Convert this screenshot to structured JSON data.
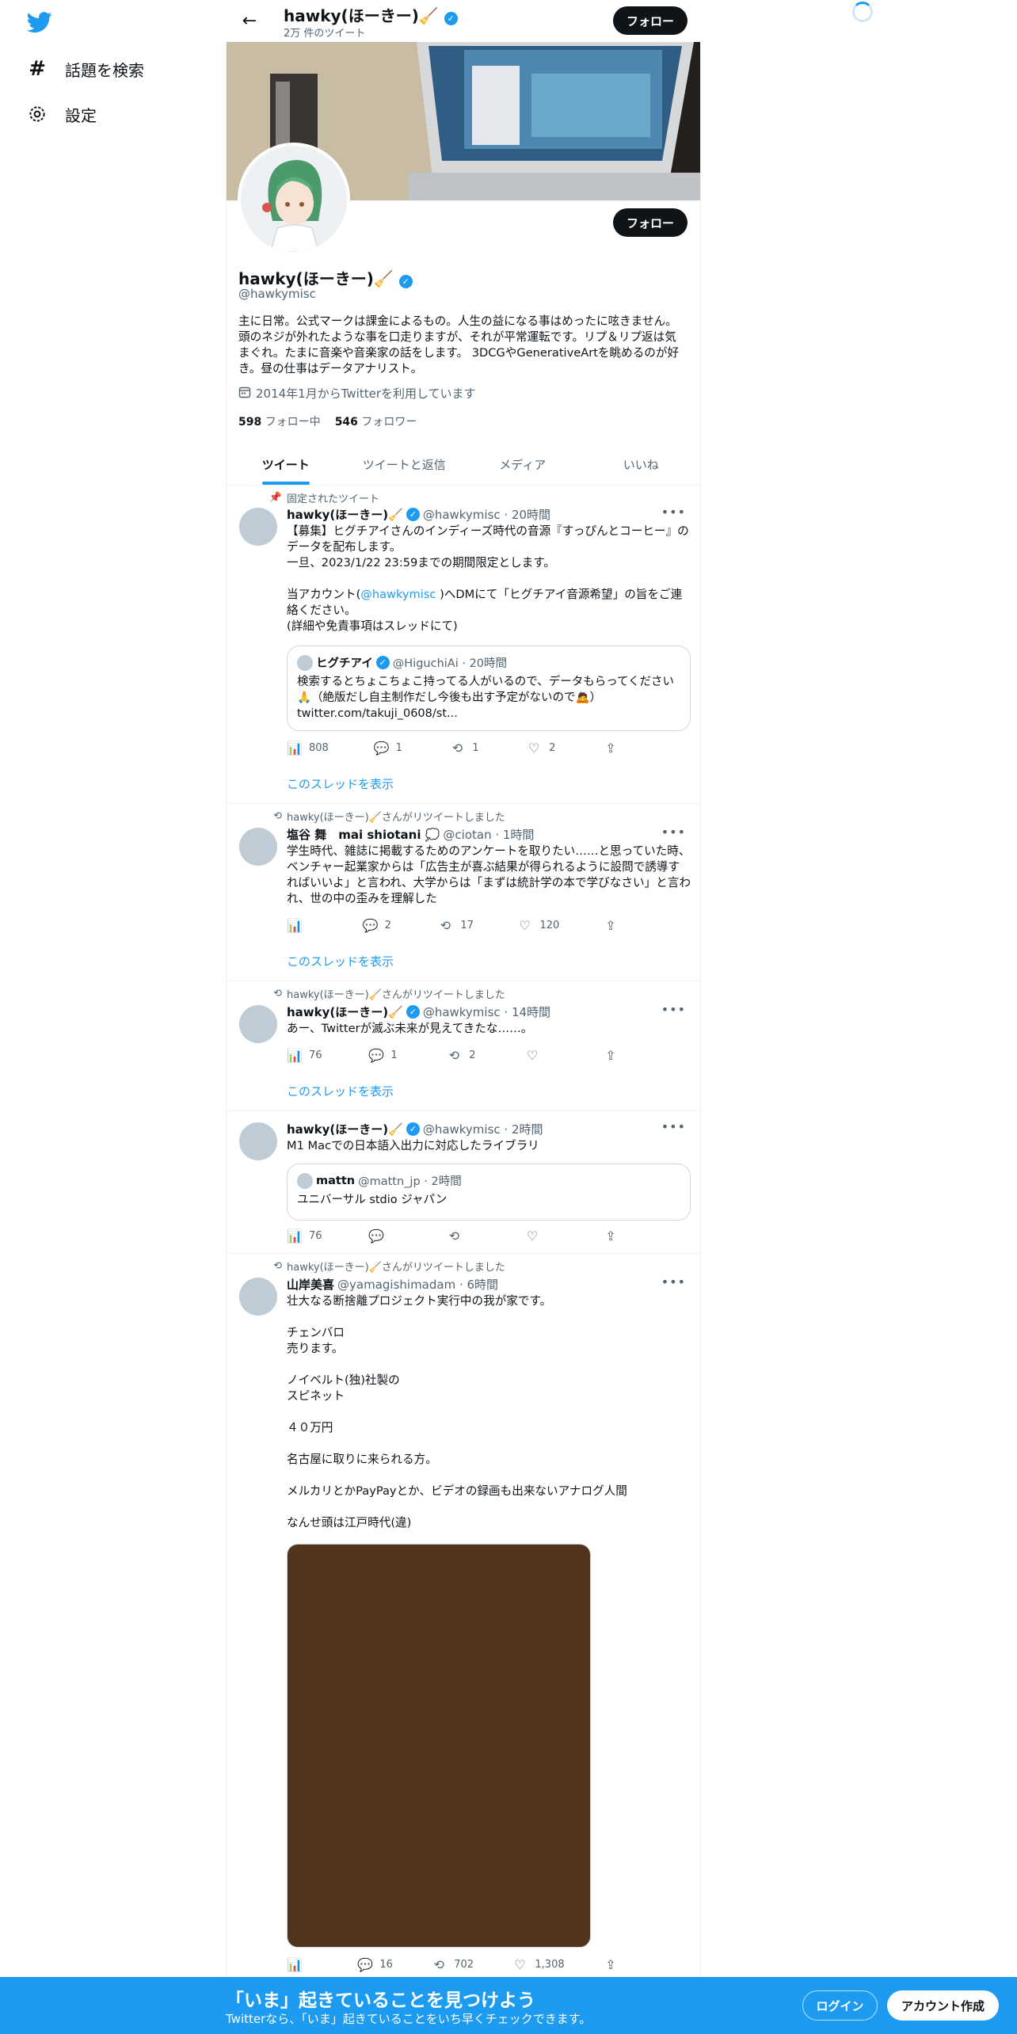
{
  "nav": {
    "logo_icon": "twitter-bird-icon",
    "items": [
      {
        "icon": "hashtag-icon",
        "label": "話題を検索"
      },
      {
        "icon": "gear-icon",
        "label": "設定"
      }
    ]
  },
  "header": {
    "name": "hawky(ほーきー)🧹",
    "tweet_count": "2万 件のツイート",
    "follow_label": "フォロー"
  },
  "profile": {
    "name": "hawky(ほーきー)🧹",
    "handle": "@hawkymisc",
    "bio": "主に日常。公式マークは課金によるもの。人生の益になる事はめったに呟きません。頭のネジが外れたような事を口走りますが、それが平常運転です。リプ＆リプ返は気まぐれ。たまに音楽や音楽家の話をします。 3DCGやGenerativeArtを眺めるのが好き。昼の仕事はデータアナリスト。",
    "joined": "2014年1月からTwitterを利用しています",
    "following_count": "598",
    "following_label": "フォロー中",
    "followers_count": "546",
    "followers_label": "フォロワー",
    "follow_label": "フォロー"
  },
  "tabs": [
    {
      "label": "ツイート",
      "active": true
    },
    {
      "label": "ツイートと返信",
      "active": false
    },
    {
      "label": "メディア",
      "active": false
    },
    {
      "label": "いいね",
      "active": false
    }
  ],
  "tweets": [
    {
      "context": "固定されたツイート",
      "name": "hawky(ほーきー)🧹",
      "meta": "@hawkymisc · 20時間",
      "body_1": "【募集】ヒグチアイさんのインディーズ時代の音源『すっぴんとコーヒー』のデータを配布します。\n一旦、2023/1/22 23:59までの期間限定とします。\n\n当アカウント(",
      "body_link": "@hawkymisc",
      "body_2": " )へDMにて「ヒグチアイ音源希望」の旨をご連絡ください。\n(詳細や免責事項はスレッドにて)",
      "quote": {
        "name": "ヒグチアイ",
        "meta": "@HiguchiAi · 20時間",
        "body": "検索するとちょこちょこ持ってる人がいるので、データもらってください🙏（絶版だし自主制作だし今後も出す予定がないので🙇）\ntwitter.com/takuji_0608/st..."
      },
      "views": "808",
      "replies": "1",
      "retweets": "1",
      "likes": "2",
      "thread": "このスレッドを表示"
    },
    {
      "context": "hawky(ほーきー)🧹さんがリツイートしました",
      "name": "塩谷 舞　mai shiotani 💭",
      "meta": "@ciotan · 1時間",
      "body": "学生時代、雑誌に掲載するためのアンケートを取りたい……と思っていた時、ベンチャー起業家からは「広告主が喜ぶ結果が得られるように設問で誘導すればいいよ」と言われ、大学からは「まずは統計学の本で学びなさい」と言われ、世の中の歪みを理解した",
      "views": "",
      "replies": "2",
      "retweets": "17",
      "likes": "120",
      "thread": "このスレッドを表示"
    },
    {
      "context": "hawky(ほーきー)🧹さんがリツイートしました",
      "name": "hawky(ほーきー)🧹",
      "meta": "@hawkymisc · 14時間",
      "body": "あー、Twitterが滅ぶ未来が見えてきたな……。",
      "views": "76",
      "replies": "1",
      "retweets": "2",
      "likes": "",
      "thread": "このスレッドを表示"
    },
    {
      "name": "hawky(ほーきー)🧹",
      "meta": "@hawkymisc · 2時間",
      "body": "M1 Macでの日本語入出力に対応したライブラリ",
      "quote": {
        "name": "mattn",
        "meta": "@mattn_jp · 2時間",
        "body": "ユニバーサル stdio ジャパン"
      },
      "views": "76",
      "replies": "",
      "retweets": "",
      "likes": ""
    },
    {
      "context": "hawky(ほーきー)🧹さんがリツイートしました",
      "name": "山岸美喜",
      "meta": "@yamagishimadam · 6時間",
      "body": "壮大なる断捨離プロジェクト実行中の我が家です。\n\nチェンバロ\n売ります。\n\nノイベルト(独)社製の\nスピネット\n\n４０万円\n\n名古屋に取りに来られる方。\n\nメルカリとかPayPayとか、ビデオの録画も出来ないアナログ人間\n\nなんせ頭は江戸時代(違)",
      "views": "",
      "replies": "16",
      "retweets": "702",
      "likes": "1,308"
    }
  ],
  "bottom": {
    "title": "「いま」起きていることを見つけよう",
    "subtitle": "Twitterなら、「いま」起きていることをいち早くチェックできます。",
    "login": "ログイン",
    "signup": "アカウント作成"
  }
}
